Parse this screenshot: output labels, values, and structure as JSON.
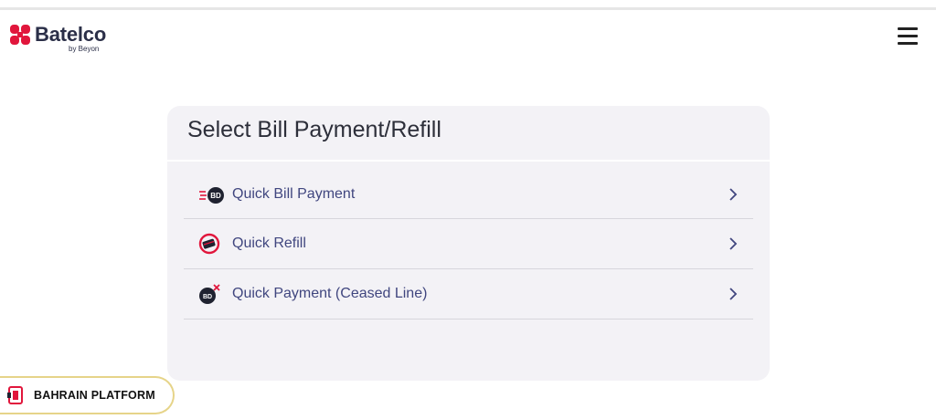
{
  "header": {
    "brand": "Batelco",
    "brand_sub": "by Beyon"
  },
  "card": {
    "title": "Select Bill Payment/Refill",
    "items": [
      {
        "label": "Quick Bill Payment",
        "icon": "bill-payment-icon"
      },
      {
        "label": "Quick Refill",
        "icon": "refill-icon"
      },
      {
        "label": "Quick Payment (Ceased Line)",
        "icon": "ceased-line-payment-icon"
      }
    ]
  },
  "watermark": {
    "text": "BAHRAIN PLATFORM"
  },
  "colors": {
    "accent": "#e1163c",
    "link": "#40467f",
    "card_bg": "#f3f2f6"
  }
}
